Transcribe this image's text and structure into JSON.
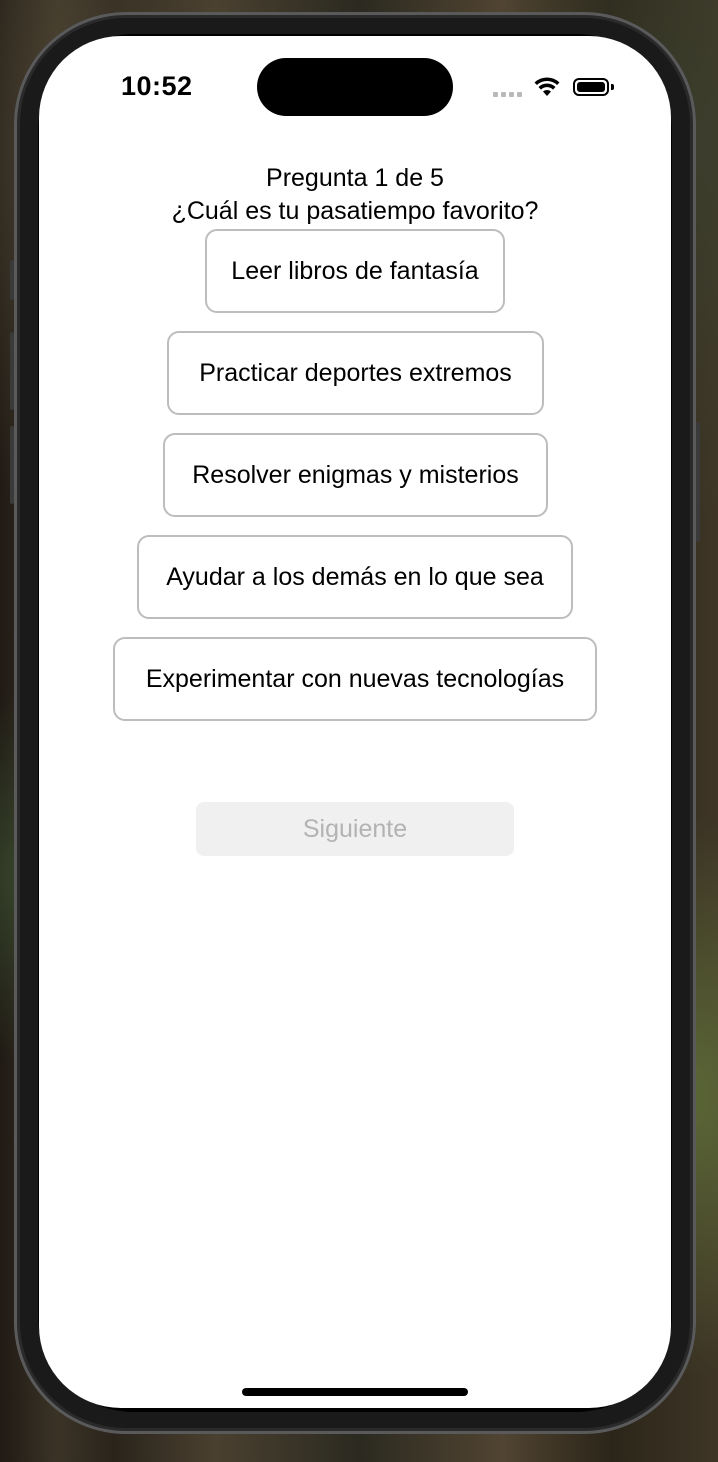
{
  "status_bar": {
    "time": "10:52",
    "signal_icon": "cellular-signal-icon",
    "wifi_icon": "wifi-icon",
    "battery_icon": "battery-icon"
  },
  "quiz": {
    "counter": "Pregunta 1 de 5",
    "question": "¿Cuál es tu pasatiempo favorito?",
    "options": [
      "Leer libros de fantasía",
      "Practicar deportes extremos",
      "Resolver enigmas y misterios",
      "Ayudar a los demás en lo que sea",
      "Experimentar con nuevas tecnologías"
    ],
    "next_label": "Siguiente",
    "next_enabled": false
  },
  "colors": {
    "option_border": "#bdbdbd",
    "next_bg_disabled": "#f0f0f0",
    "next_text_disabled": "#b3b3b3"
  }
}
